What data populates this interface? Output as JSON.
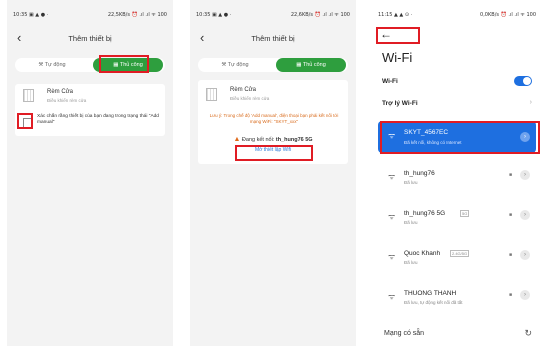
{
  "screen1": {
    "status_left": "10:35 ▣ ▲ ●  ·",
    "status_right": "22,5KB/s ⏰ .ıl .ıl ᯤ 100",
    "title": "Thêm thiết bị",
    "mode_auto": "Tự động",
    "mode_manual": "Thủ công",
    "device_name": "Rèm Cửa",
    "device_sub": "Điều khiển rèm cửa",
    "confirm_text": "Xác chắn rằng thiết bị của bạn đang trong trạng thái \"Add manual\""
  },
  "screen2": {
    "status_left": "10:35 ▣ ▲ ●  ·",
    "status_right": "22,6KB/s ⏰ .ıl .ıl ᯤ 100",
    "title": "Thêm thiết bị",
    "mode_auto": "Tự động",
    "mode_manual": "Thủ công",
    "device_name": "Rèm Cửa",
    "device_sub": "Điều khiển rèm cửa",
    "warning_text": "Lưu ý: Trong chế độ 'Add manual', điện thoại bạn phải kết nối tới mạng WiFi: \"SKYT_xxx\"",
    "connected_label": "Đang kết nối:",
    "connected_network": "th_hung76 5G",
    "change_link": "Mở thiết lập Wifi"
  },
  "screen3": {
    "status_left": "11:15 ▲ ▲ ⊙  ·",
    "status_right": "0,0KB/s ⏰ .ıl .ıl ᯤ 100",
    "title": "Wi-Fi",
    "wifi_label": "Wi-Fi",
    "assistant_label": "Trợ lý Wi-Fi",
    "networks": [
      {
        "name": "SKYT_4567EC",
        "sub": "Đã kết nối, không có Internet",
        "badge": ""
      },
      {
        "name": "th_hung76",
        "sub": "Đã lưu",
        "badge": ""
      },
      {
        "name": "th_hung76 5G",
        "sub": "Đã lưu",
        "badge": "5G"
      },
      {
        "name": "Quoc Khanh",
        "sub": "Đã lưu",
        "badge": "2.4G/5G"
      },
      {
        "name": "THUONG THANH",
        "sub": "Đã lưu, tự động kết nối đã tắt",
        "badge": ""
      }
    ],
    "available_label": "Mạng có sẵn"
  },
  "colors": {
    "accent_green": "#2e9e3e",
    "accent_blue": "#1e6fe0",
    "highlight_red": "#e01c24",
    "warning_orange": "#d96b1c"
  }
}
